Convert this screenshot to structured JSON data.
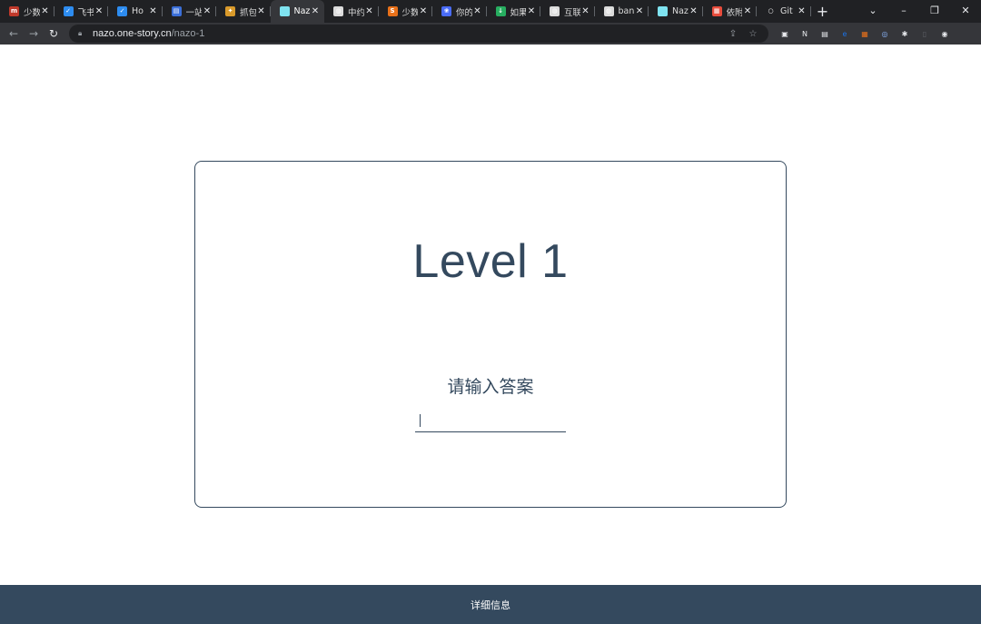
{
  "browser": {
    "tabs": [
      {
        "title": "少数",
        "fav_color": "#c0392b",
        "fav_glyph": "m",
        "active": false
      },
      {
        "title": "飞书",
        "fav_color": "#2d8cf0",
        "fav_glyph": "✓",
        "active": false
      },
      {
        "title": "Ho",
        "fav_color": "#2d8cf0",
        "fav_glyph": "✓",
        "active": false
      },
      {
        "title": "一站",
        "fav_color": "#3b6fd8",
        "fav_glyph": "▤",
        "active": false
      },
      {
        "title": "抓包",
        "fav_color": "#d99a2b",
        "fav_glyph": "✦",
        "active": false
      },
      {
        "title": "Naz",
        "fav_color": "#7fe3f0",
        "fav_glyph": "",
        "active": true
      },
      {
        "title": "中约",
        "fav_color": "#dcdcdc",
        "fav_glyph": "◍",
        "active": false
      },
      {
        "title": "少数",
        "fav_color": "#e8711a",
        "fav_glyph": "S",
        "active": false
      },
      {
        "title": "你的",
        "fav_color": "#4a6cf7",
        "fav_glyph": "❀",
        "active": false
      },
      {
        "title": "如果",
        "fav_color": "#27ae60",
        "fav_glyph": "↓",
        "active": false
      },
      {
        "title": "互联",
        "fav_color": "#dcdcdc",
        "fav_glyph": "◍",
        "active": false
      },
      {
        "title": "ban",
        "fav_color": "#dcdcdc",
        "fav_glyph": "◍",
        "active": false
      },
      {
        "title": "Naz",
        "fav_color": "#7fe3f0",
        "fav_glyph": "",
        "active": false
      },
      {
        "title": "依附",
        "fav_color": "#e74c3c",
        "fav_glyph": "▦",
        "active": false
      },
      {
        "title": "Git",
        "fav_color": "#202124",
        "fav_glyph": "○",
        "active": false
      }
    ],
    "new_tab_glyph": "+",
    "window_controls": {
      "menu": "⌄",
      "minimize": "–",
      "restore": "❐",
      "close": "✕"
    },
    "close_glyph": "✕",
    "nav": {
      "back": "←",
      "forward": "→",
      "reload": "↻"
    },
    "url_host": "nazo.one-story.cn",
    "url_path": "/nazo-1",
    "omnibox_icons": {
      "share": "⇪",
      "star": "☆"
    },
    "extensions": [
      {
        "name": "ext-1",
        "color": "#e8eaed",
        "glyph": "▣"
      },
      {
        "name": "ext-2",
        "color": "#e8eaed",
        "glyph": "N"
      },
      {
        "name": "ext-3",
        "color": "#e8eaed",
        "glyph": "▤"
      },
      {
        "name": "ext-4",
        "color": "#1a73e8",
        "glyph": "e"
      },
      {
        "name": "ext-5",
        "color": "#e8711a",
        "glyph": "▦"
      },
      {
        "name": "ext-6",
        "color": "#8ab4f8",
        "glyph": "◎"
      },
      {
        "name": "ext-7",
        "color": "#e8eaed",
        "glyph": "✱"
      },
      {
        "name": "ext-8",
        "color": "#5f6368",
        "glyph": "▯"
      },
      {
        "name": "ext-9",
        "color": "#e8eaed",
        "glyph": "◉"
      }
    ]
  },
  "page": {
    "level_title": "Level 1",
    "prompt": "请输入答案",
    "answer_value": "",
    "footer_link": "详细信息"
  }
}
